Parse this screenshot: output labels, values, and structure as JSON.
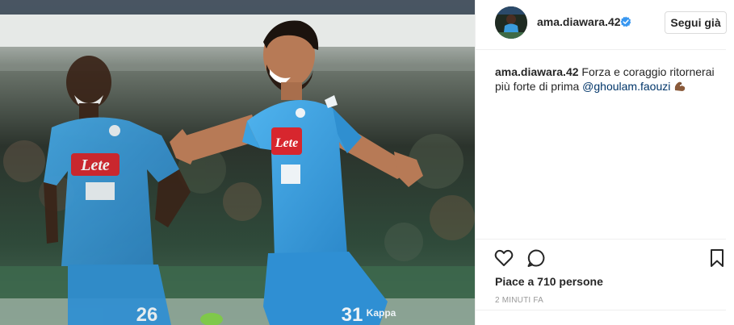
{
  "post": {
    "username": "ama.diawara.42",
    "follow_label": "Segui già",
    "caption": {
      "username": "ama.diawara.42",
      "text": "Forza e coraggio ritornerai più forte di prima",
      "mention": "@ghoulam.faouzi",
      "emoji": "flexed-biceps-icon"
    },
    "likes_text": "Piace a 710 persone",
    "time_text": "2 MINUTI FA",
    "photo": {
      "player_left_number": "26",
      "player_right_number": "31",
      "sponsor": "Lete",
      "kit_brand": "Kappa"
    }
  },
  "icons": [
    "verified-badge-icon",
    "heart-icon",
    "comment-icon",
    "bookmark-icon"
  ],
  "colors": {
    "kit_blue": "#3a9bdc",
    "verified_blue": "#3897f0",
    "sponsor_red": "#d7262e",
    "mention": "#003569"
  }
}
